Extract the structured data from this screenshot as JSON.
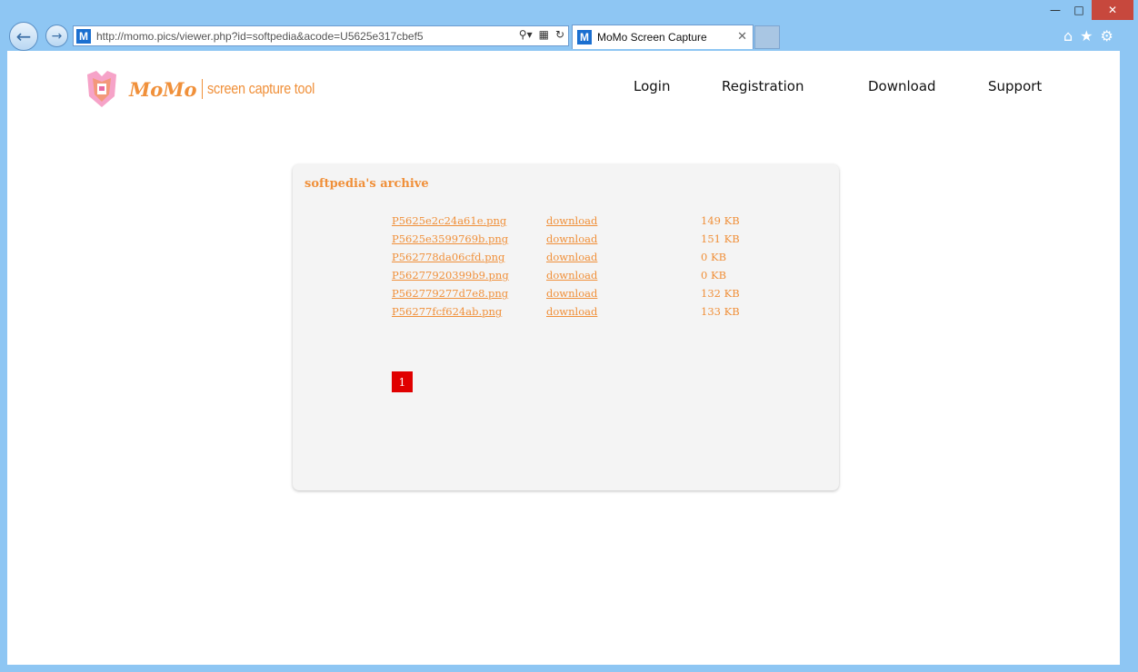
{
  "browser": {
    "url": "http://momo.pics/viewer.php?id=softpedia&acode=U5625e317cbef5",
    "tab_title": "MoMo Screen Capture",
    "site_icon": "M",
    "window_controls": [
      "minimize-icon",
      "maximize-icon",
      "close-icon"
    ],
    "toolbar_icons": [
      "home-icon",
      "star-icon",
      "gear-icon"
    ]
  },
  "site": {
    "logo_name": "MoMo",
    "logo_tagline": "screen capture tool",
    "nav": [
      "Login",
      "Registration",
      "Download",
      "Support"
    ]
  },
  "archive": {
    "title": "softpedia's archive",
    "files": [
      {
        "name": "P5625e2c24a61e.png",
        "action": "download",
        "size": "149 KB"
      },
      {
        "name": "P5625e3599769b.png",
        "action": "download",
        "size": "151 KB"
      },
      {
        "name": "P562778da06cfd.png",
        "action": "download",
        "size": "0 KB"
      },
      {
        "name": "P56277920399b9.png",
        "action": "download",
        "size": "0 KB"
      },
      {
        "name": "P562779277d7e8.png",
        "action": "download",
        "size": "132 KB"
      },
      {
        "name": "P56277fcf624ab.png",
        "action": "download",
        "size": "133 KB"
      }
    ],
    "page": "1"
  },
  "colors": {
    "accent": "#f0903a",
    "pager": "#e00000",
    "chrome": "#8ec6f3"
  }
}
